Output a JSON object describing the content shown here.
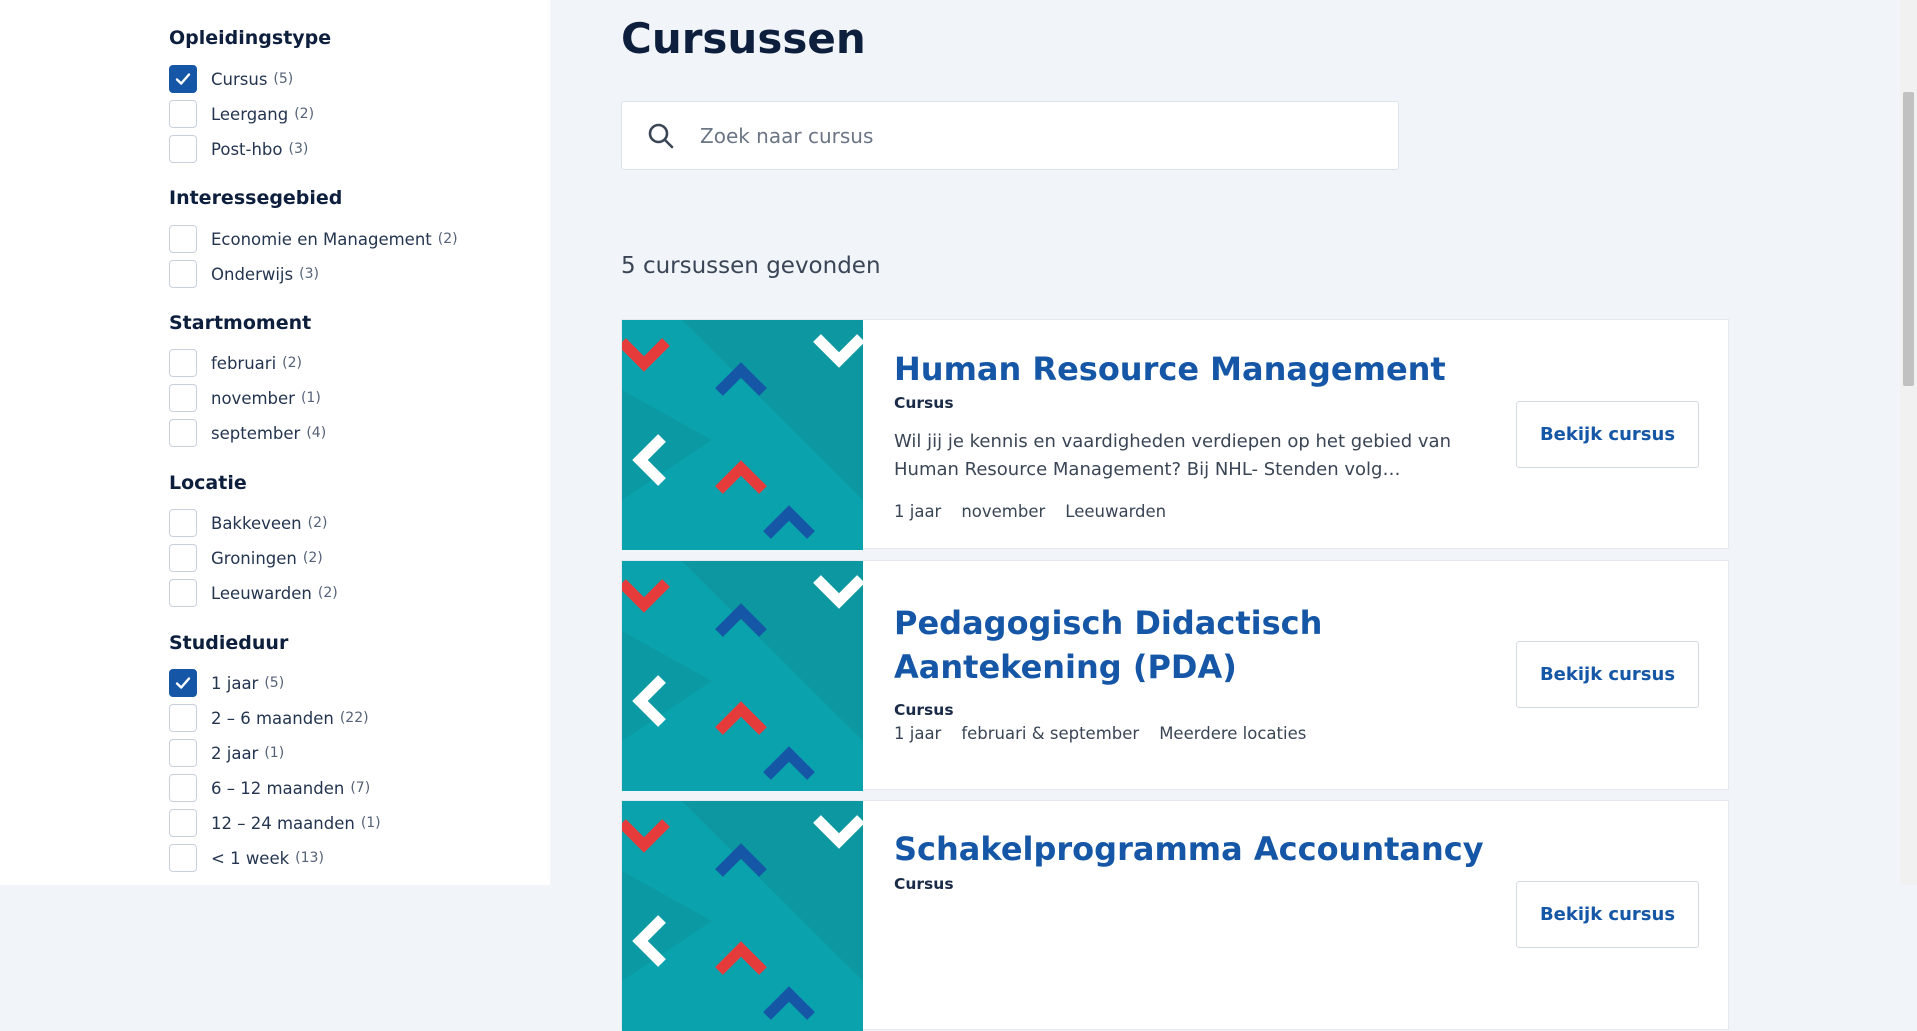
{
  "sidebar": {
    "groups": [
      {
        "title": "Opleidingstype",
        "options": [
          {
            "label": "Cursus",
            "count": "(5)",
            "checked": true
          },
          {
            "label": "Leergang",
            "count": "(2)",
            "checked": false
          },
          {
            "label": "Post-hbo",
            "count": "(3)",
            "checked": false
          }
        ]
      },
      {
        "title": "Interessegebied",
        "options": [
          {
            "label": "Economie en Management",
            "count": "(2)",
            "checked": false
          },
          {
            "label": "Onderwijs",
            "count": "(3)",
            "checked": false
          }
        ]
      },
      {
        "title": "Startmoment",
        "options": [
          {
            "label": "februari",
            "count": "(2)",
            "checked": false
          },
          {
            "label": "november",
            "count": "(1)",
            "checked": false
          },
          {
            "label": "september",
            "count": "(4)",
            "checked": false
          }
        ]
      },
      {
        "title": "Locatie",
        "options": [
          {
            "label": "Bakkeveen",
            "count": "(2)",
            "checked": false
          },
          {
            "label": "Groningen",
            "count": "(2)",
            "checked": false
          },
          {
            "label": "Leeuwarden",
            "count": "(2)",
            "checked": false
          }
        ]
      },
      {
        "title": "Studieduur",
        "options": [
          {
            "label": "1 jaar",
            "count": "(5)",
            "checked": true
          },
          {
            "label": "2 – 6 maanden",
            "count": "(22)",
            "checked": false
          },
          {
            "label": "2 jaar",
            "count": "(1)",
            "checked": false
          },
          {
            "label": "6 – 12 maanden",
            "count": "(7)",
            "checked": false
          },
          {
            "label": "12 – 24 maanden",
            "count": "(1)",
            "checked": false
          },
          {
            "label": "< 1 week",
            "count": "(13)",
            "checked": false
          }
        ]
      }
    ]
  },
  "main": {
    "title": "Cursussen",
    "search": {
      "placeholder": "Zoek naar cursus",
      "icon": "search-icon"
    },
    "result_count": "5 cursussen gevonden",
    "courses": [
      {
        "title": "Human Resource Management",
        "type": "Cursus",
        "description": "Wil jij je kennis en vaardigheden verdiepen op het gebied van Human Resource Management? Bij NHL- Stenden volg…",
        "duration": "1 jaar",
        "start": "november",
        "location": "Leeuwarden",
        "button": "Bekijk cursus"
      },
      {
        "title": "Pedagogisch Didactisch Aantekening (PDA)",
        "type": "Cursus",
        "duration": "1 jaar",
        "start": "februari & september",
        "location": "Meerdere locaties",
        "button": "Bekijk cursus"
      },
      {
        "title": "Schakelprogramma Accountancy",
        "type": "Cursus",
        "button": "Bekijk cursus"
      }
    ]
  },
  "colors": {
    "accent_blue": "#1557a6",
    "teal_image": "#0aa3ad",
    "red_chevron": "#e63b3b",
    "navy_text": "#0d1f3c",
    "page_bg": "#f1f5f9"
  }
}
